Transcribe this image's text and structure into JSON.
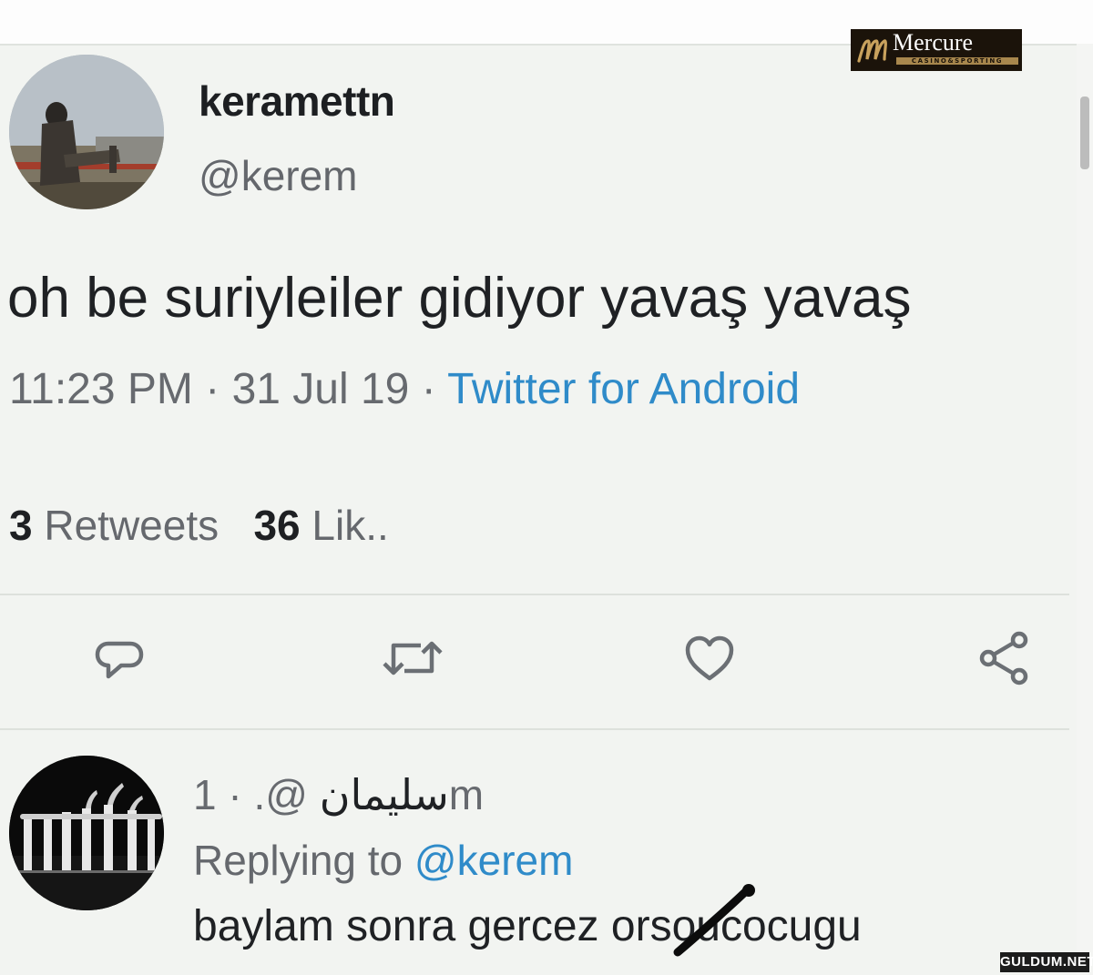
{
  "watermark": {
    "brand": "Mercure",
    "brand_tagline": "CASINO&SPORTING",
    "site": "GULDUM.NET"
  },
  "tweet": {
    "display_name": "keramettn",
    "handle": "@kerem",
    "text": "oh be suriyleiler gidiyor yavaş yavaş",
    "time": "11:23 PM",
    "date": "31 Jul 19",
    "separator": "·",
    "source": "Twitter for Android",
    "retweets_count": "3",
    "retweets_label": "Retweets",
    "likes_count": "36",
    "likes_label": "Lik.."
  },
  "actions": {
    "reply_icon": "speech-bubble-icon",
    "retweet_icon": "retweet-icon",
    "like_icon": "heart-icon",
    "share_icon": "share-icon"
  },
  "reply": {
    "display_name": "سليمان",
    "handle": "@.",
    "separator": "·",
    "age": "1m",
    "replying_prefix": "Replying to",
    "replying_handle": "@kerem",
    "text_before": "baylam sonra gercez or",
    "text_after": "soucocugu"
  },
  "colors": {
    "link_blue": "#2f8bc9",
    "text_dark": "#1f2124",
    "text_muted": "#676a6f",
    "background": "#f2f4f1"
  }
}
